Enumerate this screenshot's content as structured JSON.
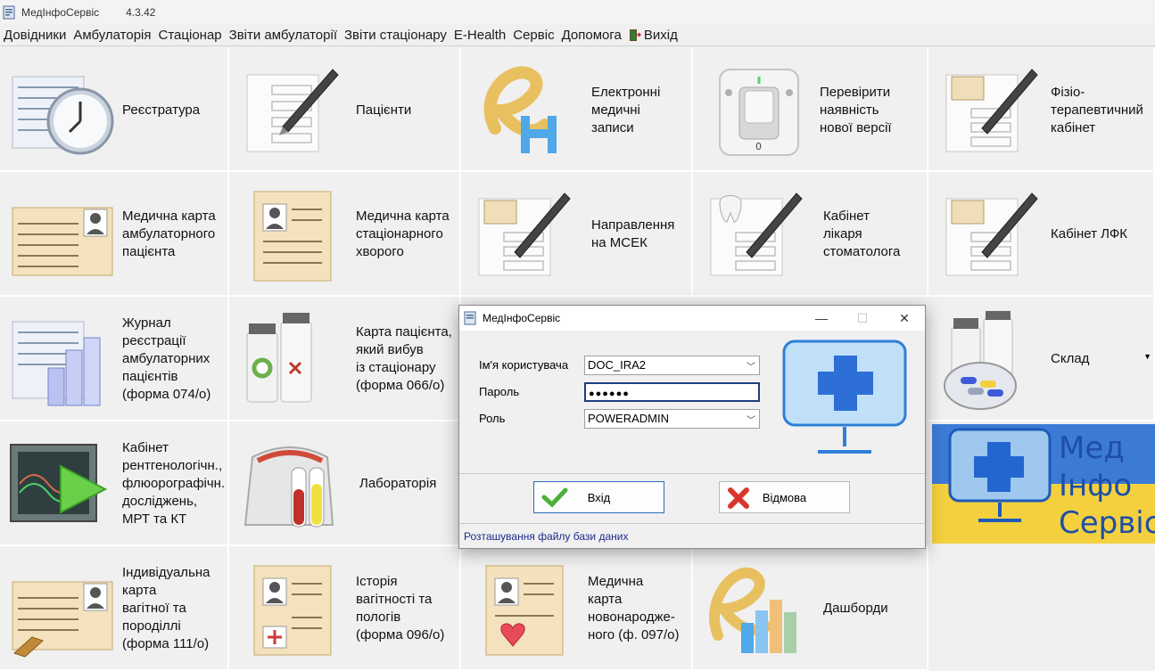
{
  "window": {
    "title": "МедІнфоСервіс",
    "version": "4.3.42"
  },
  "menu": [
    "Довідники",
    "Амбулаторія",
    "Стаціонар",
    "Звіти амбулаторії",
    "Звіти стаціонару",
    "E-Health",
    "Сервіс",
    "Допомога",
    "Вихід"
  ],
  "tiles": {
    "registry": [
      "Реєстратура"
    ],
    "patients": [
      "Пацієнти"
    ],
    "ehr": [
      "Електронні",
      "медичні",
      "записи"
    ],
    "check_version": [
      "Перевірити",
      "наявність",
      "нової версії"
    ],
    "physio": [
      "Фізіо-",
      "терапевтичний",
      "кабінет"
    ],
    "outpatient_card": [
      "Медична карта",
      "амбулаторного",
      "пацієнта"
    ],
    "inpatient_card": [
      "Медична карта",
      "стаціонарного",
      "хворого"
    ],
    "msek": [
      "Направлення",
      "на МСЕК"
    ],
    "dentist": [
      "Кабінет",
      "лікаря",
      "стоматолога"
    ],
    "lfk": [
      "Кабінет ЛФК"
    ],
    "journal": [
      "Журнал",
      "реєстрації",
      "амбулаторних",
      "пацієнтів",
      "(форма 074/о)"
    ],
    "discharge_card": [
      "Карта пацієнта,",
      "який вибув",
      "із стаціонару",
      "(форма 066/о)"
    ],
    "warehouse": [
      "Склад"
    ],
    "xray": [
      "Кабінет",
      "рентгенологічн.,",
      "флюорографічн.",
      "досліджень,",
      "МРТ та КТ"
    ],
    "lab": [
      "Лабораторія"
    ],
    "pregnancy_card": [
      "Індивідуальна",
      "карта",
      "вагітної та",
      "породіллі",
      "(форма 111/о)"
    ],
    "birth_history": [
      "Історія",
      "вагітності та",
      "пологів",
      "(форма 096/о)"
    ],
    "newborn_card": [
      "Медична",
      "карта",
      "новонародже-",
      "ного (ф. 097/о)"
    ],
    "dashboards": [
      "Дашборди"
    ]
  },
  "brand": {
    "lines": [
      "Мед",
      "Інфо",
      "Сервіс"
    ]
  },
  "dialog": {
    "title": "МедІнфоСервіс",
    "username_label": "Ім'я користувача",
    "username_value": "DOC_IRA2",
    "password_label": "Пароль",
    "password_value": "●●●●●●",
    "role_label": "Роль",
    "role_value": "POWERADMIN",
    "ok_label": "Вхід",
    "cancel_label": "Відмова",
    "db_link": "Розташування файлу бази даних"
  },
  "colors": {
    "accent_blue": "#2f7fd8",
    "ukraine_blue": "#3b7bd6",
    "ukraine_yellow": "#f4d03f"
  }
}
